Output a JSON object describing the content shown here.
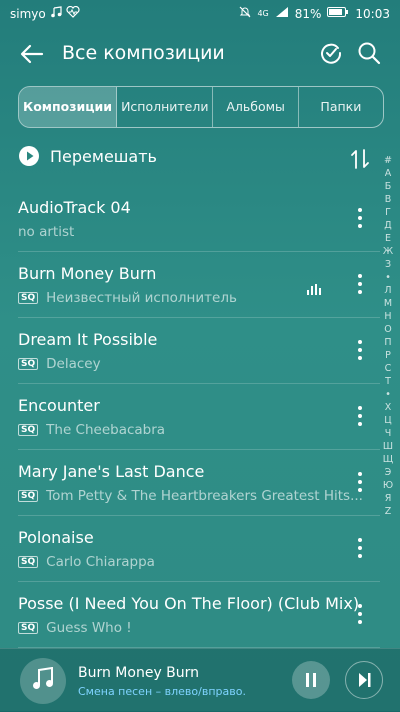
{
  "status": {
    "carrier": "simyo",
    "battery": "81%",
    "time": "10:03",
    "network": "4G"
  },
  "header": {
    "title": "Все композиции"
  },
  "tabs": [
    {
      "label": "Композиции"
    },
    {
      "label": "Исполнители"
    },
    {
      "label": "Альбомы"
    },
    {
      "label": "Папки"
    }
  ],
  "shuffle": {
    "label": "Перемешать"
  },
  "alphabet": [
    "#",
    "А",
    "Б",
    "В",
    "Г",
    "Д",
    "Е",
    "Ж",
    "З",
    "•",
    "Л",
    "М",
    "Н",
    "О",
    "П",
    "Р",
    "С",
    "Т",
    "•",
    "Х",
    "Ц",
    "Ч",
    "Ш",
    "Щ",
    "Э",
    "Ю",
    "Я",
    "Z"
  ],
  "songs": [
    {
      "title": "AudioTrack 04",
      "artist": "no artist",
      "sq": false,
      "playing": false
    },
    {
      "title": "Burn Money Burn",
      "artist": "Неизвестный исполнитель",
      "sq": true,
      "playing": true
    },
    {
      "title": "Dream It Possible",
      "artist": "Delacey",
      "sq": true,
      "playing": false
    },
    {
      "title": "Encounter",
      "artist": "The Cheebacabra",
      "sq": true,
      "playing": false
    },
    {
      "title": "Mary Jane's Last Dance",
      "artist": "Tom Petty & The Heartbreakers Greatest Hits...",
      "sq": true,
      "playing": false
    },
    {
      "title": "Polonaise",
      "artist": "Carlo Chiarappa",
      "sq": true,
      "playing": false
    },
    {
      "title": "Posse (I Need You On The Floor) (Club Mix)",
      "artist": "Guess Who !",
      "sq": true,
      "playing": false
    }
  ],
  "sq_badge": "SQ",
  "player": {
    "song": "Burn Money Burn",
    "hint": "Смена песен – влево/вправо."
  },
  "colors": {
    "accent_hint": "#7fd3ff",
    "background": "#2f8f88"
  }
}
